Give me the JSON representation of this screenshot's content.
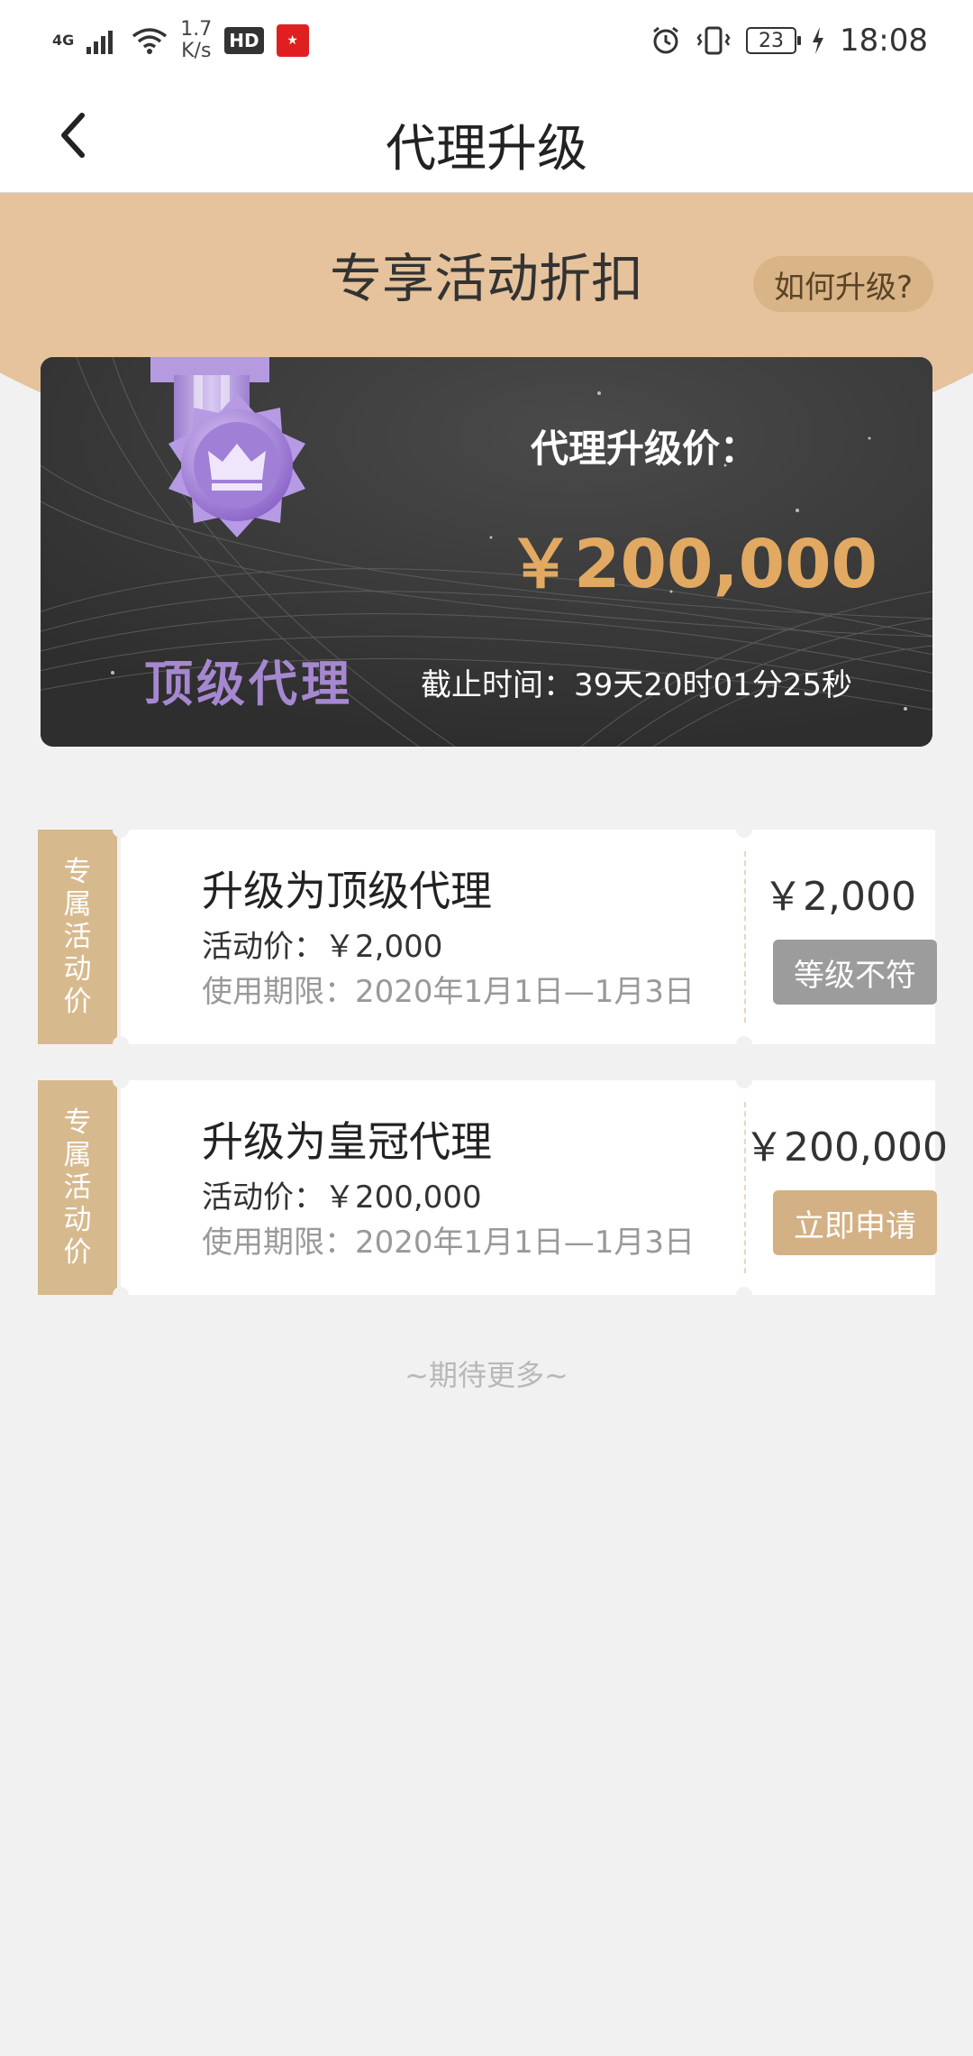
{
  "status_bar": {
    "network": "4G",
    "speed_value": "1.7",
    "speed_unit": "K/s",
    "hd": "HD",
    "battery": "23",
    "time": "18:08"
  },
  "nav": {
    "title": "代理升级"
  },
  "hero": {
    "title": "专享活动折扣",
    "how_button": "如何升级?"
  },
  "card": {
    "level_name": "顶级代理",
    "price_label": "代理升级价：",
    "price_value": "￥200,000",
    "deadline": "截止时间：39天20时01分25秒"
  },
  "coupons": [
    {
      "tag": [
        "专",
        "属",
        "活",
        "动",
        "价"
      ],
      "title": "升级为顶级代理",
      "price": "活动价：￥2,000",
      "period": "使用期限：2020年1月1日—1月3日",
      "amount": "￥2,000",
      "button": "等级不符"
    },
    {
      "tag": [
        "专",
        "属",
        "活",
        "动",
        "价"
      ],
      "title": "升级为皇冠代理",
      "price": "活动价：￥200,000",
      "period": "使用期限：2020年1月1日—1月3日",
      "amount": "￥200,000",
      "button": "立即申请"
    }
  ],
  "footer": {
    "more": "~期待更多~"
  },
  "colors": {
    "accent_gold": "#e2a962",
    "hero_bg": "#e6c39c",
    "tag_bg": "#d7b98e",
    "disabled_btn": "#9c9c9c",
    "apply_btn": "#d3b184",
    "medal_purple": "#a688d0"
  }
}
